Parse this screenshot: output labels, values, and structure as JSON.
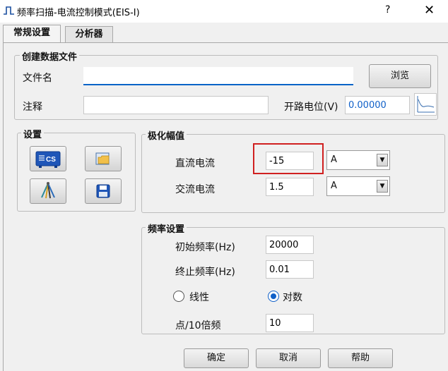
{
  "window": {
    "title": "频率扫描-电流控制模式(EIS-I)",
    "help": "?",
    "close": "✕"
  },
  "tabs": [
    {
      "label": "常规设置",
      "active": true
    },
    {
      "label": "分析器",
      "active": false
    }
  ],
  "create_file": {
    "legend": "创建数据文件",
    "filename_label": "文件名",
    "filename_value": "",
    "browse_label": "浏览",
    "note_label": "注释",
    "note_value": "",
    "ocp_label": "开路电位(V)",
    "ocp_value": "0.00000"
  },
  "settings": {
    "legend": "设置",
    "icons": [
      "cs-device-icon",
      "open-folder-icon",
      "electrode-leads-icon",
      "save-disk-icon"
    ]
  },
  "polarization": {
    "legend": "极化幅值",
    "dc_label": "直流电流",
    "dc_value": "-15",
    "dc_unit": "A",
    "ac_label": "交流电流",
    "ac_value": "1.5",
    "ac_unit": "A"
  },
  "frequency": {
    "legend": "频率设置",
    "start_label": "初始频率(Hz)",
    "start_value": "20000",
    "end_label": "终止频率(Hz)",
    "end_value": "0.01",
    "linear_label": "线性",
    "log_label": "对数",
    "selected_scale": "对数",
    "points_label": "点/10倍频",
    "points_value": "10"
  },
  "buttons": {
    "ok": "确定",
    "cancel": "取消",
    "help": "帮助"
  },
  "colors": {
    "accent": "#1060c8",
    "highlight": "#d02020"
  }
}
